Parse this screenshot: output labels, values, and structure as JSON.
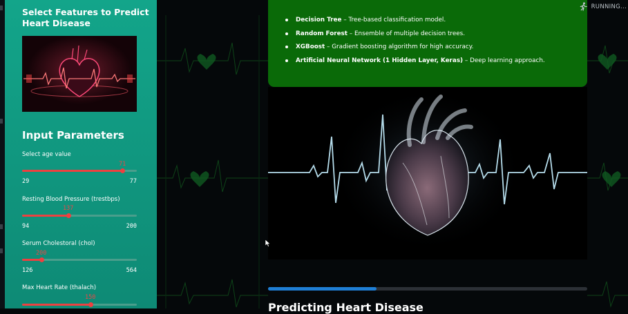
{
  "status": {
    "running_label": "RUNNING...",
    "icon": "running-person-icon"
  },
  "sidebar": {
    "title": "Select Features to Predict Heart Disease",
    "image": "heart-ekg-image",
    "inputs_heading": "Input Parameters",
    "params": [
      {
        "label": "Select age value",
        "value": "71",
        "min": "29",
        "max": "77",
        "fraction": 0.875
      },
      {
        "label": "Resting Blood Pressure (trestbps)",
        "value": "137",
        "min": "94",
        "max": "200",
        "fraction": 0.405
      },
      {
        "label": "Serum Cholestoral (chol)",
        "value": "200",
        "min": "126",
        "max": "564",
        "fraction": 0.169
      },
      {
        "label": "Max Heart Rate (thalach)",
        "value": "150",
        "min": "",
        "max": "",
        "fraction": 0.6
      }
    ]
  },
  "models": [
    {
      "name": "Decision Tree",
      "desc": " – Tree-based classification model."
    },
    {
      "name": "Random Forest",
      "desc": " – Ensemble of multiple decision trees."
    },
    {
      "name": "XGBoost",
      "desc": " – Gradient boosting algorithm for high accuracy."
    },
    {
      "name": "Artificial Neural Network (1 Hidden Layer, Keras)",
      "desc": " – Deep learning approach."
    }
  ],
  "main": {
    "progress_fraction": 0.34,
    "prediction_heading": "Predicting Heart Disease"
  },
  "colors": {
    "sidebar": "#13a58a",
    "slider": "#ee4040",
    "infobox": "#0a6a08",
    "progress": "#1f7fd6"
  }
}
